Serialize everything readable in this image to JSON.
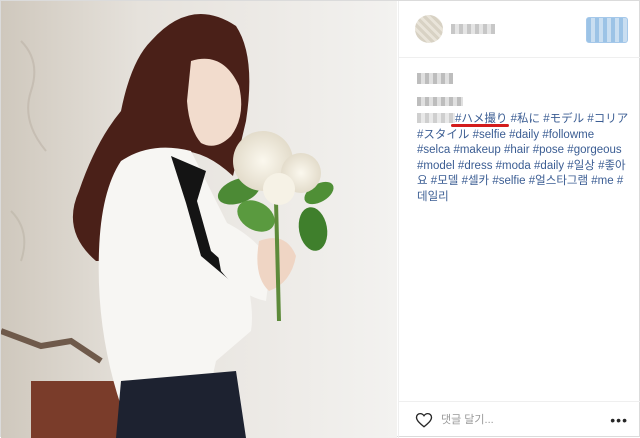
{
  "caption": {
    "text_segments": [
      {
        "text": "#ハメ撮り",
        "tag": true,
        "underline": true
      },
      {
        "text": " ",
        "tag": false
      },
      {
        "text": "#私に",
        "tag": true
      },
      {
        "text": " ",
        "tag": false
      },
      {
        "text": "#モデル",
        "tag": true
      },
      {
        "text": " ",
        "tag": false
      },
      {
        "text": "#コリア",
        "tag": true
      },
      {
        "text": " ",
        "tag": false
      },
      {
        "text": "#スタイル",
        "tag": true
      },
      {
        "text": " ",
        "tag": false
      },
      {
        "text": "#selfie",
        "tag": true
      },
      {
        "text": " ",
        "tag": false
      },
      {
        "text": "#daily",
        "tag": true
      },
      {
        "text": " ",
        "tag": false
      },
      {
        "text": "#followme",
        "tag": true
      },
      {
        "text": " ",
        "tag": false
      },
      {
        "text": "#selca",
        "tag": true
      },
      {
        "text": " ",
        "tag": false
      },
      {
        "text": "#makeup",
        "tag": true
      },
      {
        "text": " ",
        "tag": false
      },
      {
        "text": "#hair",
        "tag": true
      },
      {
        "text": " ",
        "tag": false
      },
      {
        "text": "#pose",
        "tag": true
      },
      {
        "text": " ",
        "tag": false
      },
      {
        "text": "#gorgeous",
        "tag": true
      },
      {
        "text": " ",
        "tag": false
      },
      {
        "text": "#model",
        "tag": true
      },
      {
        "text": " ",
        "tag": false
      },
      {
        "text": "#dress",
        "tag": true
      },
      {
        "text": " ",
        "tag": false
      },
      {
        "text": "#moda",
        "tag": true
      },
      {
        "text": " ",
        "tag": false
      },
      {
        "text": "#daily",
        "tag": true
      },
      {
        "text": " ",
        "tag": false
      },
      {
        "text": "#일상",
        "tag": true
      },
      {
        "text": " ",
        "tag": false
      },
      {
        "text": "#좋아요",
        "tag": true
      },
      {
        "text": " ",
        "tag": false
      },
      {
        "text": "#모델",
        "tag": true
      },
      {
        "text": " ",
        "tag": false
      },
      {
        "text": "#셀카",
        "tag": true
      },
      {
        "text": " ",
        "tag": false
      },
      {
        "text": "#selfie",
        "tag": true
      },
      {
        "text": " ",
        "tag": false
      },
      {
        "text": "#얼스타그램",
        "tag": true
      },
      {
        "text": " ",
        "tag": false
      },
      {
        "text": "#me",
        "tag": true
      },
      {
        "text": " ",
        "tag": false
      },
      {
        "text": "#데일리",
        "tag": true
      }
    ]
  },
  "footer": {
    "comment_placeholder": "댓글 달기...",
    "more_label": "•••"
  },
  "colors": {
    "hashtag": "#3b5d93",
    "underline": "#d31c1c"
  },
  "icons": {
    "like": "heart-icon",
    "more": "more-options-icon"
  }
}
